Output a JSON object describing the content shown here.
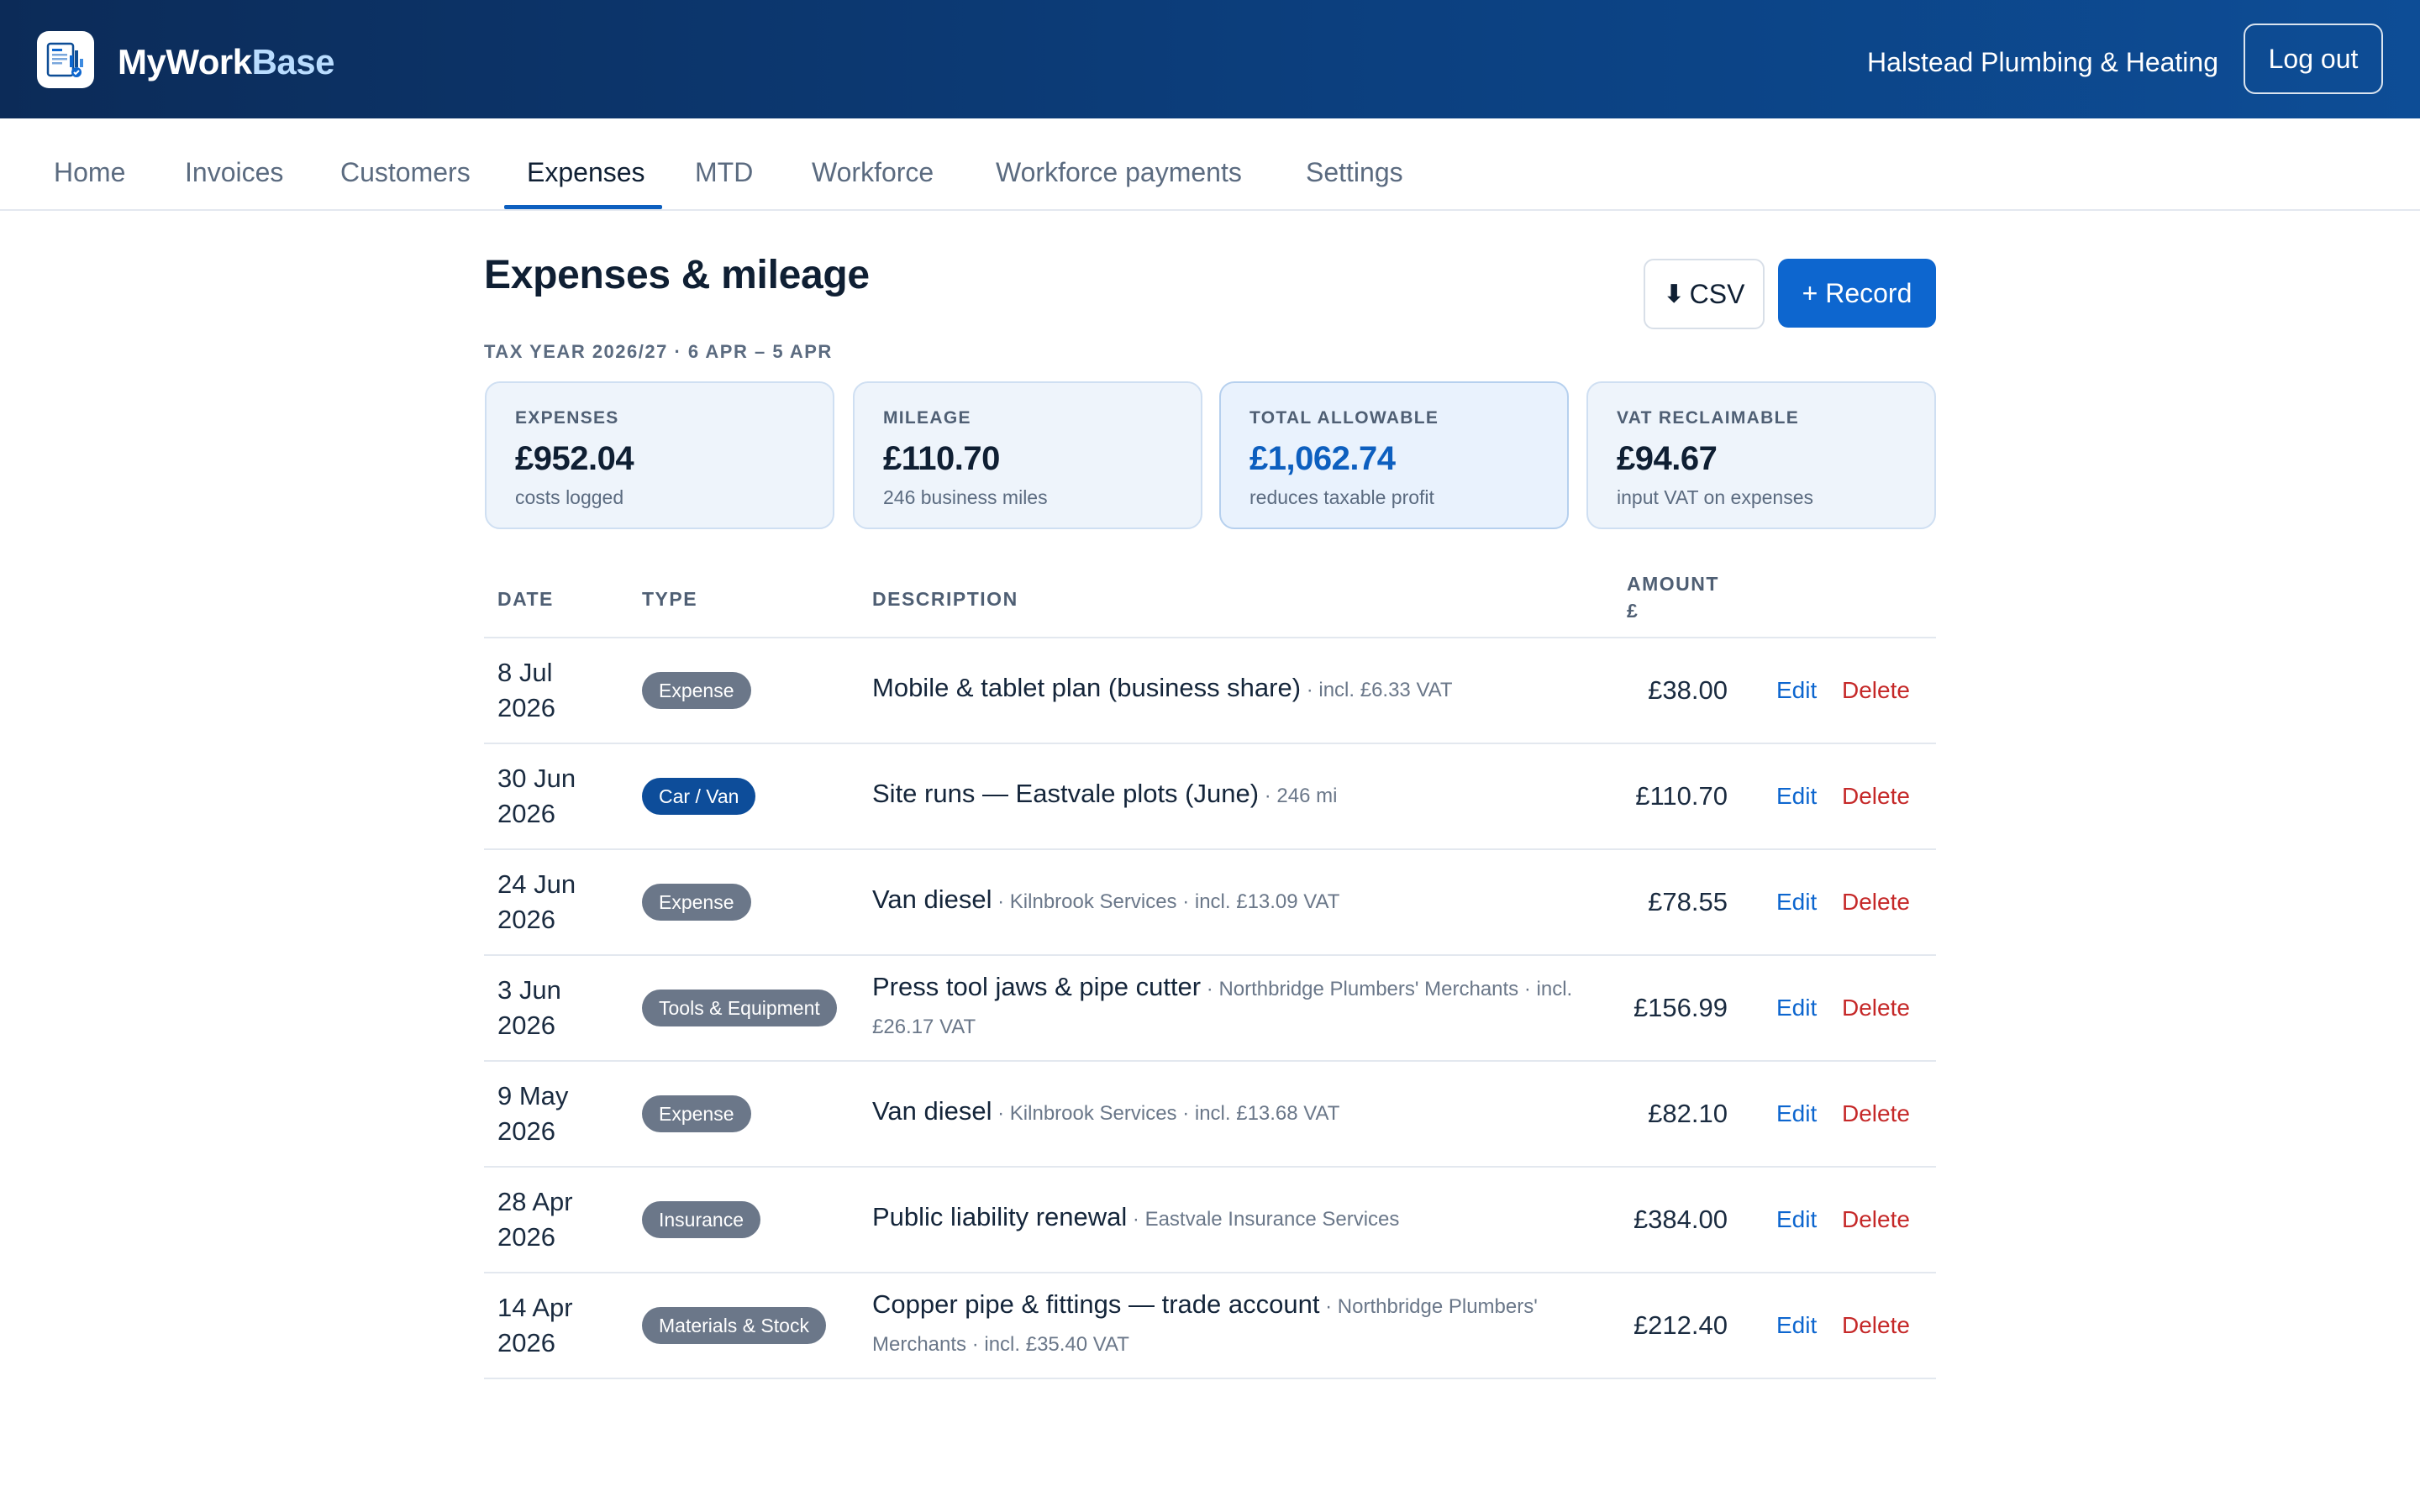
{
  "header": {
    "brand_part1": "MyWork",
    "brand_part2": "Base",
    "business_name": "Halstead Plumbing & Heating",
    "logout_label": "Log out",
    "logo_icon": "business-dashboard-icon"
  },
  "nav": {
    "tabs": [
      {
        "label": "Home",
        "active": false
      },
      {
        "label": "Invoices",
        "active": false
      },
      {
        "label": "Customers",
        "active": false
      },
      {
        "label": "Expenses",
        "active": true
      },
      {
        "label": "MTD",
        "active": false
      },
      {
        "label": "Workforce",
        "active": false
      },
      {
        "label": "Workforce payments",
        "active": false
      },
      {
        "label": "Settings",
        "active": false
      }
    ]
  },
  "page": {
    "title": "Expenses & mileage",
    "csv_label": "CSV",
    "csv_icon": "download-arrow-icon",
    "record_label": "+ Record",
    "tax_year": "TAX YEAR 2026/27 · 6 APR – 5 APR"
  },
  "summary": [
    {
      "label": "EXPENSES",
      "value": "£952.04",
      "sub": "costs logged",
      "highlight": false
    },
    {
      "label": "MILEAGE",
      "value": "£110.70",
      "sub": "246 business miles",
      "highlight": false
    },
    {
      "label": "TOTAL ALLOWABLE",
      "value": "£1,062.74",
      "sub": "reduces taxable profit",
      "highlight": true
    },
    {
      "label": "VAT RECLAIMABLE",
      "value": "£94.67",
      "sub": "input VAT on expenses",
      "highlight": false
    }
  ],
  "table": {
    "headers": {
      "date": "DATE",
      "type": "TYPE",
      "description": "DESCRIPTION",
      "amount_line1": "AMOUNT",
      "amount_line2": "£"
    },
    "edit_label": "Edit",
    "delete_label": "Delete",
    "rows": [
      {
        "date_line1": "8 Jul",
        "date_line2": "2026",
        "type": "Expense",
        "description": "Mobile & tablet plan (business share)",
        "meta": " · incl. £6.33 VAT",
        "amount": "£38.00"
      },
      {
        "date_line1": "30 Jun",
        "date_line2": "2026",
        "type": "Car / Van",
        "description": "Site runs — Eastvale plots (June)",
        "meta": " · 246 mi",
        "amount": "£110.70"
      },
      {
        "date_line1": "24 Jun",
        "date_line2": "2026",
        "type": "Expense",
        "description": "Van diesel",
        "meta": " · Kilnbrook Services · incl. £13.09 VAT",
        "amount": "£78.55"
      },
      {
        "date_line1": "3 Jun",
        "date_line2": "2026",
        "type": "Tools & Equipment",
        "description": "Press tool jaws & pipe cutter",
        "meta": " · Northbridge Plumbers' Merchants · incl. £26.17 VAT",
        "amount": "£156.99"
      },
      {
        "date_line1": "9 May",
        "date_line2": "2026",
        "type": "Expense",
        "description": "Van diesel",
        "meta": " · Kilnbrook Services · incl. £13.68 VAT",
        "amount": "£82.10"
      },
      {
        "date_line1": "28 Apr",
        "date_line2": "2026",
        "type": "Insurance",
        "description": "Public liability renewal",
        "meta": " · Eastvale Insurance Services",
        "amount": "£384.00"
      },
      {
        "date_line1": "14 Apr",
        "date_line2": "2026",
        "type": "Materials & Stock",
        "description": "Copper pipe & fittings — trade account",
        "meta": " · Northbridge Plumbers' Merchants · incl. £35.40 VAT",
        "amount": "£212.40"
      }
    ]
  },
  "colors": {
    "header_gradient_start": "#0c2b58",
    "header_gradient_end": "#0d4d96",
    "accent": "#0d66cf",
    "delete": "#c52828",
    "badge_default": "#6b7789",
    "badge_vehicle": "#0d4d9a"
  }
}
